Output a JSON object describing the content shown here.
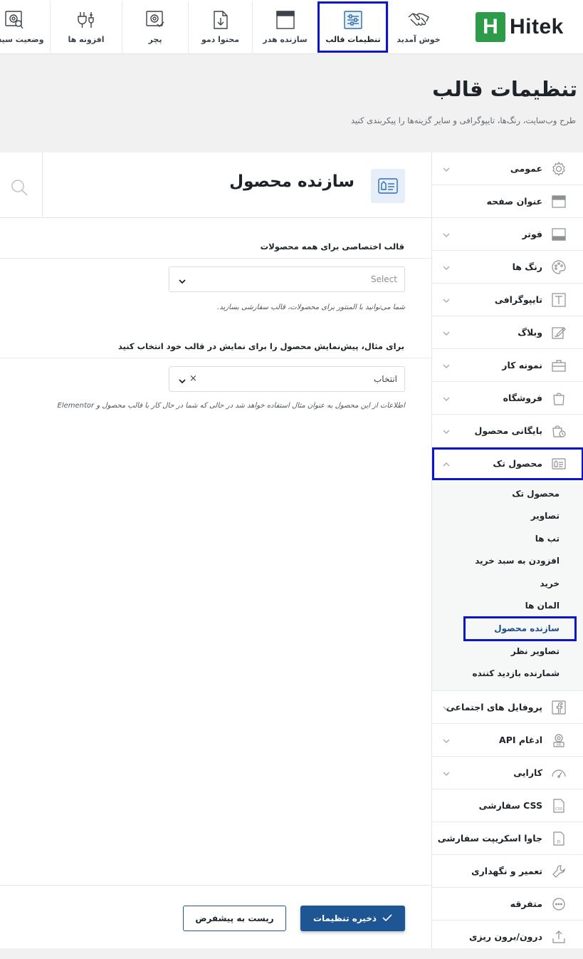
{
  "brand": {
    "mark": "H",
    "name": "Hitek",
    "color": "#2e9b4a"
  },
  "tabs": [
    {
      "label": "وضعیت سیستم",
      "icon": "system-status-icon"
    },
    {
      "label": "افزونه ها",
      "icon": "plugin-icon"
    },
    {
      "label": "پچر",
      "icon": "patcher-icon"
    },
    {
      "label": "محتوا دمو",
      "icon": "demo-import-icon"
    },
    {
      "label": "سازنده هدر",
      "icon": "header-builder-icon"
    },
    {
      "label": "تنظیمات قالب",
      "icon": "theme-settings-icon",
      "active": true
    },
    {
      "label": "خوش آمدید",
      "icon": "handshake-icon"
    }
  ],
  "page": {
    "title": "تنظیمات قالب",
    "subtitle": "طرح وب‌سایت، رنگ‌ها، تایپوگرافی و سایر گزینه‌ها را پیکربندی کنید"
  },
  "section": {
    "title": "سازنده محصول",
    "icon": "product-card-icon"
  },
  "fields": {
    "template_label": "قالب اختصاصی برای همه محصولات",
    "template_placeholder": "Select",
    "template_hint": "شما می‌توانید با المنتور برای محصولات، قالب سفارشی بسازید.",
    "preview_label": "برای مثال، پیش‌نمایش محصول را برای نمایش در قالب خود انتخاب کنید",
    "preview_value": "انتخاب",
    "preview_hint": "اطلاعات از این محصول به عنوان مثال استفاده خواهد شد در حالی که شما در حال کار با قالب محصول و Elementor"
  },
  "sidebar": {
    "items": [
      {
        "label": "عمومی",
        "icon": "gear-icon",
        "chevron": true
      },
      {
        "label": "عنوان صفحه",
        "icon": "page-title-icon",
        "chevron": false
      },
      {
        "label": "فوتر",
        "icon": "footer-icon",
        "chevron": true
      },
      {
        "label": "رنگ ها",
        "icon": "palette-icon",
        "chevron": true
      },
      {
        "label": "تایپوگرافی",
        "icon": "typography-icon",
        "chevron": true
      },
      {
        "label": "وبلاگ",
        "icon": "blog-edit-icon",
        "chevron": true
      },
      {
        "label": "نمونه کار",
        "icon": "briefcase-icon",
        "chevron": true
      },
      {
        "label": "فروشگاه",
        "icon": "shopping-bag-icon",
        "chevron": true
      },
      {
        "label": "بایگانی محصول",
        "icon": "product-archive-icon",
        "chevron": true
      },
      {
        "label": "محصول تک",
        "icon": "single-product-icon",
        "chevron": true,
        "open": true
      },
      {
        "label": "پروفایل های اجتماعی",
        "icon": "facebook-icon",
        "chevron": true
      },
      {
        "label": "ادغام API",
        "icon": "api-icon",
        "chevron": true
      },
      {
        "label": "کارایی",
        "icon": "speedometer-icon",
        "chevron": true
      },
      {
        "label": "CSS سفارشی",
        "icon": "css-file-icon",
        "chevron": false
      },
      {
        "label": "جاوا اسکریپت سفارشی",
        "icon": "js-file-icon",
        "chevron": false
      },
      {
        "label": "تعمیر و نگهداری",
        "icon": "wrench-icon",
        "chevron": false
      },
      {
        "label": "متفرقه",
        "icon": "more-dots-icon",
        "chevron": false
      },
      {
        "label": "درون/برون ریزی",
        "icon": "import-export-icon",
        "chevron": false
      }
    ],
    "submenu": [
      {
        "label": "محصول تک"
      },
      {
        "label": "تصاویر"
      },
      {
        "label": "تب ها"
      },
      {
        "label": "افزودن به سبد خرید"
      },
      {
        "label": "خرید"
      },
      {
        "label": "المان ها"
      },
      {
        "label": "سازنده محصول",
        "active": true
      },
      {
        "label": "تصاویر نظر"
      },
      {
        "label": "شمارنده بازدید کننده"
      }
    ]
  },
  "actions": {
    "save_label": "ذخیره تنظیمات",
    "reset_label": "ریست به پیشفرض"
  },
  "colors": {
    "accent": "#1e5693",
    "highlight": "#0a16c8"
  }
}
